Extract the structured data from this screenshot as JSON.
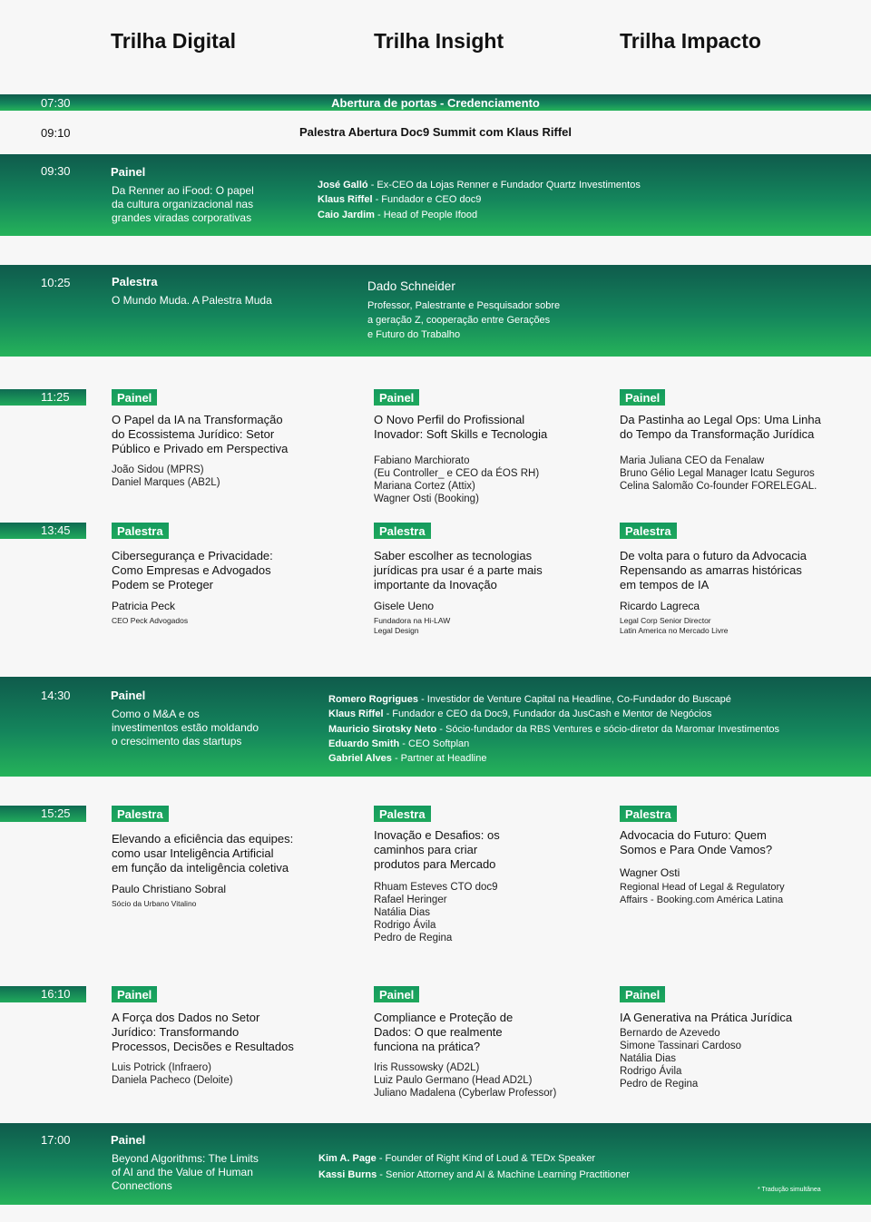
{
  "header": {
    "tracks": [
      "Trilha Digital",
      "Trilha Insight",
      "Trilha Impacto"
    ]
  },
  "opening": {
    "time": "07:30",
    "label": "Abertura de portas - Credenciamento"
  },
  "keynote": {
    "time": "09:10",
    "label": "Palestra Abertura Doc9 Summit com Klaus Riffel"
  },
  "panel_0930": {
    "time": "09:30",
    "type": "Painel",
    "title": "Da Renner ao iFood: O papel\nda cultura organizacional nas\ngrandes viradas corporativas",
    "guests": [
      {
        "name": "José Galló",
        "role": " - Ex-CEO da Lojas Renner e Fundador  Quartz Investimentos"
      },
      {
        "name": "Klaus Riffel",
        "role": " - Fundador e CEO doc9"
      },
      {
        "name": "Caio Jardim",
        "role": " - Head of People Ifood"
      }
    ]
  },
  "talk_1025": {
    "time": "10:25",
    "type": "Palestra",
    "title": "O Mundo Muda. A Palestra Muda",
    "speaker": "Dado Schneider",
    "bio": "Professor, Palestrante e Pesquisador sobre\na geração Z, cooperação entre Gerações\ne Futuro do Trabalho"
  },
  "slot_1125": {
    "time": "11:25",
    "cells": [
      {
        "type": "Painel",
        "title": "O Papel da IA na Transformação\ndo Ecossistema Jurídico: Setor\nPúblico e Privado em Perspectiva",
        "people": "João Sidou (MPRS)\nDaniel  Marques (AB2L)"
      },
      {
        "type": "Painel",
        "title": "O Novo Perfil do Profissional\nInovador: Soft Skills e Tecnologia",
        "people": "Fabiano Marchiorato\n(Eu Controller_ e CEO da ÉOS RH)\nMariana Cortez (Attix)\nWagner Osti (Booking)"
      },
      {
        "type": "Painel",
        "title": "Da Pastinha ao Legal Ops: Uma Linha\ndo Tempo da Transformação Jurídica",
        "people": "Maria Juliana CEO da Fenalaw\nBruno Gélio Legal Manager Icatu Seguros\nCelina Salomão Co-founder FORELEGAL."
      }
    ]
  },
  "slot_1345": {
    "time": "13:45",
    "cells": [
      {
        "type": "Palestra",
        "title": "Cibersegurança e Privacidade:\nComo Empresas e Advogados\nPodem se Proteger",
        "speaker": "Patricia Peck",
        "role": "CEO Peck Advogados"
      },
      {
        "type": "Palestra",
        "title": "Saber escolher as tecnologias\njurídicas pra usar é a parte mais\nimportante da Inovação",
        "speaker": "Gisele Ueno",
        "role": "Fundadora na Hi-LAW\nLegal Design"
      },
      {
        "type": "Palestra",
        "title": "De volta para o futuro da Advocacia\nRepensando as amarras históricas\nem tempos de IA",
        "speaker": "Ricardo Lagreca",
        "role": "Legal Corp Senior Director\nLatin America no Mercado Livre"
      }
    ]
  },
  "panel_1430": {
    "time": "14:30",
    "type": "Painel",
    "title": "Como o M&A e os\ninvestimentos estão moldando\no crescimento das startups",
    "guests": [
      {
        "name": "Romero Rogrigues",
        "role": " - Investidor de Venture Capital na Headline, Co-Fundador do Buscapé"
      },
      {
        "name": "Klaus Riffel",
        "role": " - Fundador e CEO da Doc9, Fundador da JusCash e Mentor de Negócios"
      },
      {
        "name": "Mauricio Sirotsky Neto",
        "role": " - Sócio-fundador da RBS Ventures e sócio-diretor da Maromar Investimentos"
      },
      {
        "name": "Eduardo Smith",
        "role": " - CEO Softplan"
      },
      {
        "name": "Gabriel Alves",
        "role": " -  Partner at Headline"
      }
    ]
  },
  "slot_1525": {
    "time": "15:25",
    "cells": [
      {
        "type": "Palestra",
        "title": "Elevando a eficiência das equipes:\ncomo usar Inteligência Artificial\nem função da inteligência coletiva",
        "speaker": "Paulo Christiano Sobral",
        "role": "Sócio da Urbano Vitalino"
      },
      {
        "type": "Palestra",
        "title": "Inovação e Desafios: os\ncaminhos para criar\nprodutos para Mercado",
        "people": "Rhuam Esteves CTO doc9\nRafael Heringer\nNatália Dias\nRodrigo Ávila\nPedro de Regina"
      },
      {
        "type": "Palestra",
        "title": "Advocacia do Futuro: Quem\nSomos e Para Onde Vamos?",
        "speaker": "Wagner Osti",
        "people": "Regional Head of Legal & Regulatory\nAffairs - Booking.com América Latina"
      }
    ]
  },
  "slot_1610": {
    "time": "16:10",
    "cells": [
      {
        "type": "Painel",
        "title": "A Força dos Dados no Setor\nJurídico: Transformando\nProcessos, Decisões e Resultados",
        "people": "Luis Potrick (Infraero)\nDaniela Pacheco (Deloite)"
      },
      {
        "type": "Painel",
        "title": "Compliance e Proteção de\nDados: O que realmente\nfunciona na prática?",
        "people": "Iris Russowsky (AD2L)\nLuiz Paulo Germano (Head AD2L)\nJuliano Madalena (Cyberlaw Professor)"
      },
      {
        "type": "Painel",
        "title": "IA Generativa na Prática Jurídica",
        "people": "Bernardo de Azevedo\nSimone Tassinari Cardoso\nNatália Dias\nRodrigo Ávila\nPedro de Regina"
      }
    ]
  },
  "panel_1700": {
    "time": "17:00",
    "type": "Painel",
    "title": "Beyond Algorithms: The Limits\nof AI and the Value of Human\nConnections",
    "guests": [
      {
        "name": "Kim A. Page",
        "role": " - Founder of Right Kind of Loud & TEDx Speaker"
      },
      {
        "name": "Kassi Burns",
        "role": " - Senior Attorney and AI & Machine Learning Practitioner"
      }
    ],
    "note": "* Tradução simultânea"
  }
}
